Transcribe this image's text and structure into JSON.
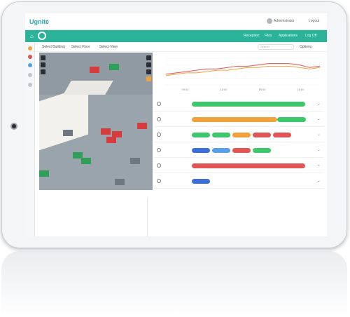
{
  "app": {
    "logo": "Ugnite",
    "user_name": "Administrator",
    "logout": "Logout"
  },
  "nav": {
    "items": [
      "Reception",
      "Files",
      "Applications",
      "Log Off"
    ]
  },
  "toolbar": {
    "dropdowns": [
      "Select Building",
      "Select Floor",
      "Select View"
    ],
    "search_placeholder": "Search",
    "right_label": "Options"
  },
  "chart_data": {
    "type": "line",
    "title": "",
    "xlabel": "",
    "ylabel": "",
    "x": [
      "t1",
      "t2",
      "t3",
      "t4",
      "t5",
      "t6",
      "t7",
      "t8",
      "t9",
      "t10",
      "t11",
      "t12",
      "t13",
      "t14",
      "t15",
      "t16"
    ],
    "series": [
      {
        "color": "#e25555",
        "values": [
          18,
          19,
          20,
          21,
          22,
          22,
          23,
          24,
          24,
          25,
          26,
          26,
          26,
          25,
          23,
          24
        ]
      },
      {
        "color": "#f2a23a",
        "values": [
          17,
          18,
          19,
          19,
          20,
          21,
          21,
          22,
          23,
          23,
          24,
          24,
          24,
          23,
          22,
          23
        ]
      }
    ],
    "ylim": [
      10,
      30
    ],
    "tick_labels": [
      "09:00",
      "12:00",
      "15:00",
      "18:00"
    ]
  },
  "rows": [
    {
      "icon": "wifi-icon",
      "bars": [
        {
          "color": "#3cc86a",
          "fill": 1.0
        }
      ],
      "chips": []
    },
    {
      "icon": "thermometer-icon",
      "bars": [
        {
          "color": "#f2a23a",
          "fill": 0.75
        },
        {
          "color": "#3cc86a",
          "fill": 0.25
        }
      ],
      "chips": []
    },
    {
      "icon": "desk-icon",
      "bars": [],
      "chips": [
        {
          "color": "#3cc86a"
        },
        {
          "color": "#3cc86a"
        },
        {
          "color": "#f2a23a"
        },
        {
          "color": "#e25555"
        },
        {
          "color": "#e25555"
        }
      ]
    },
    {
      "icon": "people-icon",
      "bars": [],
      "chips": [
        {
          "color": "#3a6fd8"
        },
        {
          "color": "#5aa0e8"
        },
        {
          "color": "#e25555"
        },
        {
          "color": "#3cc86a"
        }
      ]
    },
    {
      "icon": "co2-icon",
      "bars": [
        {
          "color": "#e25555",
          "fill": 1.0
        }
      ],
      "chips": []
    },
    {
      "icon": "noise-icon",
      "bars": [],
      "chips": [
        {
          "color": "#3a6fd8"
        }
      ]
    }
  ],
  "colors": {
    "accent": "#2bb39a",
    "green": "#3cc86a",
    "orange": "#f2a23a",
    "red": "#e25555",
    "blue": "#3a6fd8"
  }
}
